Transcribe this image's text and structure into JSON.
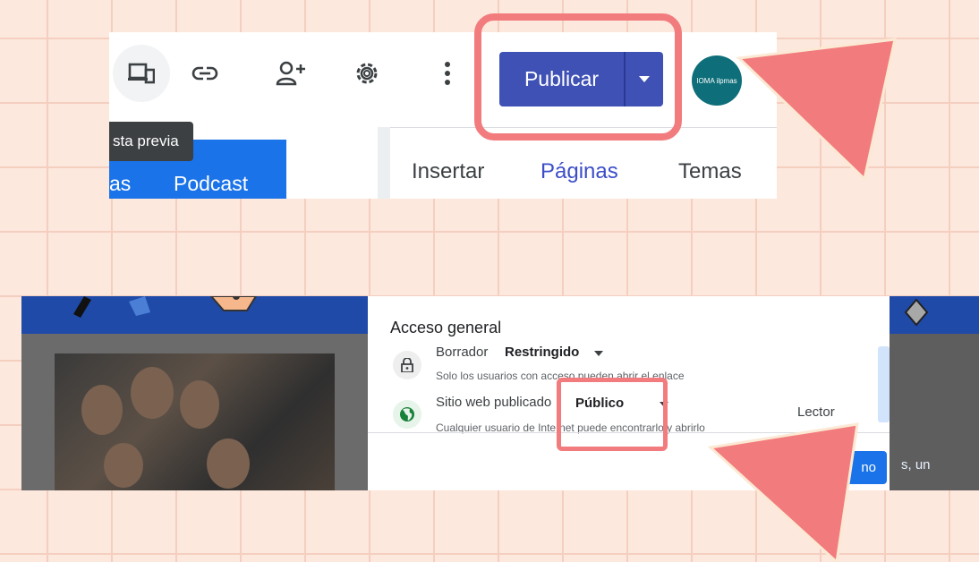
{
  "top": {
    "tooltip": "sta previa",
    "left_tabs": [
      "as",
      "Podcast"
    ],
    "right_tabs": [
      "Insertar",
      "Páginas",
      "Temas"
    ],
    "active_tab": "Páginas",
    "publish_label": "Publicar",
    "avatar_text": "IOMA ilpmas",
    "icons": [
      "preview-device-icon",
      "link-icon",
      "add-person-icon",
      "gear-icon",
      "more-vert-icon",
      "chevron-down-icon"
    ]
  },
  "sharing": {
    "title": "Acceso general",
    "draft": {
      "label": "Borrador",
      "value": "Restringido",
      "description": "Solo los usuarios con acceso pueden abrir el enlace"
    },
    "published": {
      "label": "Sitio web publicado",
      "value": "Público",
      "description": "Cualquier usuario de Internet puede encontrarlo y abrirlo",
      "role": "Lector"
    },
    "done_label": "no",
    "side_text": "s, un"
  },
  "colors": {
    "background": "#fde8dd",
    "grid": "#f4cfc0",
    "highlight": "#f27b7e",
    "publish_button": "#3f51b5",
    "blue_tab": "#1a73e8"
  }
}
